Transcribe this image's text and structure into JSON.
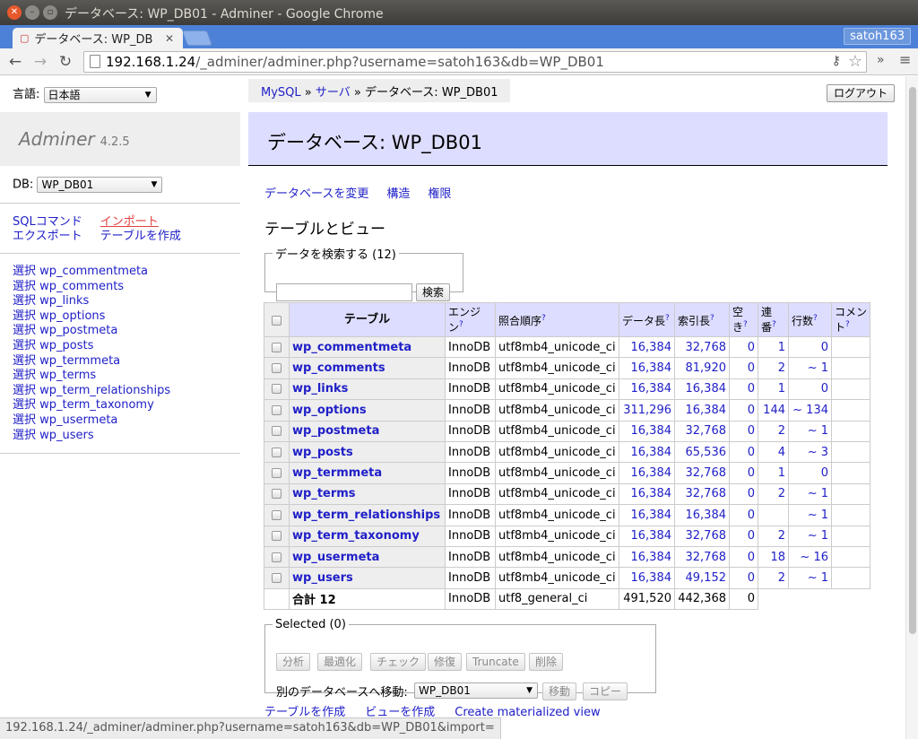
{
  "window": {
    "title": "データベース: WP_DB01 - Adminer - Google Chrome",
    "tab_title": "データベース: WP_DB",
    "user": "satoh163",
    "url_host": "192.168.1.24",
    "url_path": "/_adminer/adminer.php?username=satoh163&db=WP_DB01",
    "status_url": "192.168.1.24/_adminer/adminer.php?username=satoh163&db=WP_DB01&import="
  },
  "sidebar": {
    "lang_label": "言語:",
    "lang_value": "日本語",
    "brand": "Adminer",
    "version": "4.2.5",
    "db_label": "DB:",
    "db_value": "WP_DB01",
    "links": [
      {
        "label": "SQLコマンド"
      },
      {
        "label": "インポート"
      },
      {
        "label": "エクスポート"
      },
      {
        "label": "テーブルを作成"
      }
    ],
    "select_label": "選択",
    "tables": [
      "wp_commentmeta",
      "wp_comments",
      "wp_links",
      "wp_options",
      "wp_postmeta",
      "wp_posts",
      "wp_termmeta",
      "wp_terms",
      "wp_term_relationships",
      "wp_term_taxonomy",
      "wp_usermeta",
      "wp_users"
    ]
  },
  "header": {
    "breadcrumb": {
      "mysql": "MySQL",
      "sep1": " » ",
      "server": "サーバ",
      "sep2": " » ",
      "current": "データベース: WP_DB01"
    },
    "logout": "ログアウト",
    "title": "データベース: WP_DB01"
  },
  "sublinks": [
    "データベースを変更",
    "構造",
    "権限"
  ],
  "section_title": "テーブルとビュー",
  "search": {
    "legend": "データを検索する (12)",
    "button": "検索"
  },
  "table": {
    "headers": {
      "table": "テーブル",
      "engine1": "エンジ",
      "engine2": "ン",
      "collation": "照合順序",
      "data_len": "データ長",
      "index_len": "索引長",
      "free1": "空",
      "free2": "き",
      "autoinc1": "連",
      "autoinc2": "番",
      "rows": "行数",
      "comment1": "コメン",
      "comment2": "ト",
      "help": "?"
    },
    "rows": [
      {
        "name": "wp_commentmeta",
        "engine": "InnoDB",
        "collation": "utf8mb4_unicode_ci",
        "data": "16,384",
        "index": "32,768",
        "free": "0",
        "autoinc": "1",
        "rows": "0"
      },
      {
        "name": "wp_comments",
        "engine": "InnoDB",
        "collation": "utf8mb4_unicode_ci",
        "data": "16,384",
        "index": "81,920",
        "free": "0",
        "autoinc": "2",
        "rows": "~ 1"
      },
      {
        "name": "wp_links",
        "engine": "InnoDB",
        "collation": "utf8mb4_unicode_ci",
        "data": "16,384",
        "index": "16,384",
        "free": "0",
        "autoinc": "1",
        "rows": "0"
      },
      {
        "name": "wp_options",
        "engine": "InnoDB",
        "collation": "utf8mb4_unicode_ci",
        "data": "311,296",
        "index": "16,384",
        "free": "0",
        "autoinc": "144",
        "rows": "~ 134"
      },
      {
        "name": "wp_postmeta",
        "engine": "InnoDB",
        "collation": "utf8mb4_unicode_ci",
        "data": "16,384",
        "index": "32,768",
        "free": "0",
        "autoinc": "2",
        "rows": "~ 1"
      },
      {
        "name": "wp_posts",
        "engine": "InnoDB",
        "collation": "utf8mb4_unicode_ci",
        "data": "16,384",
        "index": "65,536",
        "free": "0",
        "autoinc": "4",
        "rows": "~ 3"
      },
      {
        "name": "wp_termmeta",
        "engine": "InnoDB",
        "collation": "utf8mb4_unicode_ci",
        "data": "16,384",
        "index": "32,768",
        "free": "0",
        "autoinc": "1",
        "rows": "0"
      },
      {
        "name": "wp_terms",
        "engine": "InnoDB",
        "collation": "utf8mb4_unicode_ci",
        "data": "16,384",
        "index": "32,768",
        "free": "0",
        "autoinc": "2",
        "rows": "~ 1"
      },
      {
        "name": "wp_term_relationships",
        "engine": "InnoDB",
        "collation": "utf8mb4_unicode_ci",
        "data": "16,384",
        "index": "16,384",
        "free": "0",
        "autoinc": "",
        "rows": "~ 1"
      },
      {
        "name": "wp_term_taxonomy",
        "engine": "InnoDB",
        "collation": "utf8mb4_unicode_ci",
        "data": "16,384",
        "index": "32,768",
        "free": "0",
        "autoinc": "2",
        "rows": "~ 1"
      },
      {
        "name": "wp_usermeta",
        "engine": "InnoDB",
        "collation": "utf8mb4_unicode_ci",
        "data": "16,384",
        "index": "32,768",
        "free": "0",
        "autoinc": "18",
        "rows": "~ 16"
      },
      {
        "name": "wp_users",
        "engine": "InnoDB",
        "collation": "utf8mb4_unicode_ci",
        "data": "16,384",
        "index": "49,152",
        "free": "0",
        "autoinc": "2",
        "rows": "~ 1"
      }
    ],
    "total": {
      "label": "合計 12",
      "engine": "InnoDB",
      "collation": "utf8_general_ci",
      "data": "491,520",
      "index": "442,368",
      "free": "0"
    }
  },
  "selected": {
    "legend": "Selected (0)",
    "buttons": [
      "分析",
      "最適化",
      "チェック",
      "修復",
      "Truncate",
      "削除"
    ],
    "move_label": "別のデータベースへ移動:",
    "move_db": "WP_DB01",
    "move_button": "移動",
    "copy_button": "コピー"
  },
  "footer_links": [
    "テーブルを作成",
    "ビューを作成",
    "Create materialized view"
  ]
}
